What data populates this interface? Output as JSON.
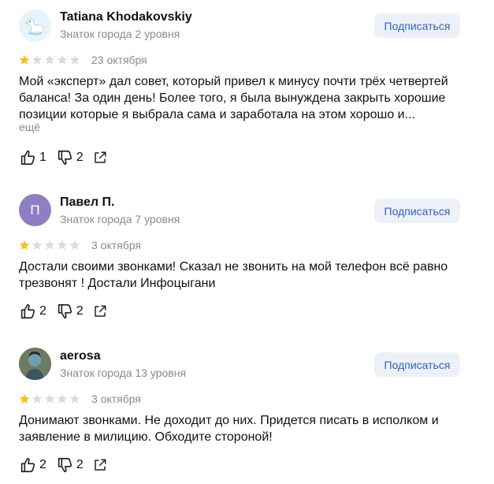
{
  "subscribe_label": "Подписаться",
  "more_label": "ещё",
  "colors": {
    "star_filled": "#fcbe18",
    "star_empty": "#dcdcdc",
    "accent": "#2c64c7"
  },
  "reviews": [
    {
      "author": "Tatiana Khodakovskiy",
      "avatar": "swan-avatar",
      "level": "Знаток города 2 уровня",
      "rating": 1,
      "date": "23 октября",
      "text": "Мой «эксперт» дал совет, который привел к минусу почти трёх четвертей баланса! За один день! Более того, я была вынуждена закрыть хорошие позиции которые я выбрала сама и заработала на этом хорошо и...",
      "likes": "1",
      "dislikes": "2"
    },
    {
      "author": "Павел П.",
      "avatar_letter": "П",
      "level": "Знаток города 7 уровня",
      "rating": 1,
      "date": "3 октября",
      "text": "Достали своими звонками! Сказал не звонить на мой телефон всё равно трезвонят ! Достали Инфоцыгани",
      "likes": "2",
      "dislikes": "2"
    },
    {
      "author": "aerosa",
      "avatar": "photo-avatar",
      "level": "Знаток города 13 уровня",
      "rating": 1,
      "date": "3 октября",
      "text": "Донимают звонками. Не доходит до них. Придется писать в исполком и заявление в милицию. Обходите стороной!",
      "likes": "2",
      "dislikes": "2"
    }
  ]
}
